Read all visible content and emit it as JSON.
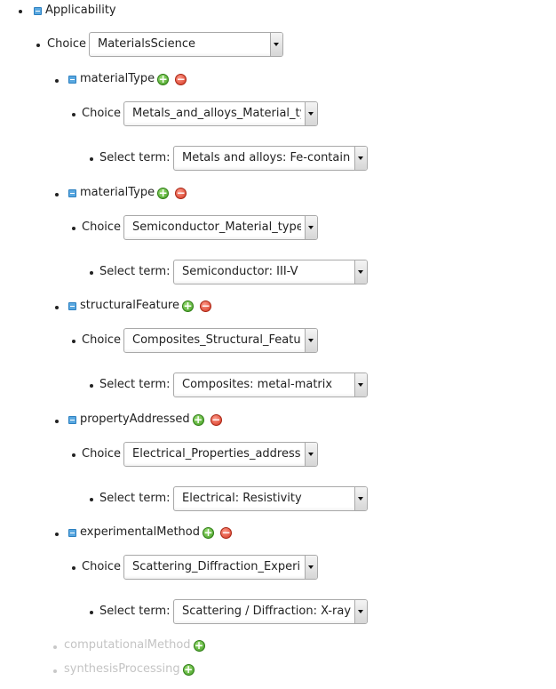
{
  "root": {
    "label": "Applicability"
  },
  "top_choice": {
    "label": "Choice",
    "value": "MaterialsScience"
  },
  "groups": [
    {
      "name": "materialType",
      "choice_label": "Choice",
      "choice_value": "Metals_and_alloys_Material_type",
      "term_label": "Select term:",
      "term_value": "Metals and alloys: Fe-containing"
    },
    {
      "name": "materialType",
      "choice_label": "Choice",
      "choice_value": "Semiconductor_Material_type",
      "term_label": "Select term:",
      "term_value": "Semiconductor: III-V"
    },
    {
      "name": "structuralFeature",
      "choice_label": "Choice",
      "choice_value": "Composites_Structural_Feature",
      "term_label": "Select term:",
      "term_value": "Composites: metal-matrix"
    },
    {
      "name": "propertyAddressed",
      "choice_label": "Choice",
      "choice_value": "Electrical_Properties_addressed",
      "term_label": "Select term:",
      "term_value": "Electrical: Resistivity"
    },
    {
      "name": "experimentalMethod",
      "choice_label": "Choice",
      "choice_value": "Scattering_Diffraction_Experimental_Method",
      "term_label": "Select term:",
      "term_value": "Scattering / Diffraction: X-ray"
    }
  ],
  "optional": [
    {
      "name": "computationalMethod"
    },
    {
      "name": "synthesisProcessing"
    }
  ],
  "colors": {
    "collapse": "#5aa8e0",
    "add": "#3f9b1f",
    "remove": "#d2341f",
    "disabled_text": "#c4c4c4"
  },
  "icons": {
    "collapse": "minus-square-icon",
    "add": "plus-circle-icon",
    "remove": "minus-circle-icon"
  }
}
